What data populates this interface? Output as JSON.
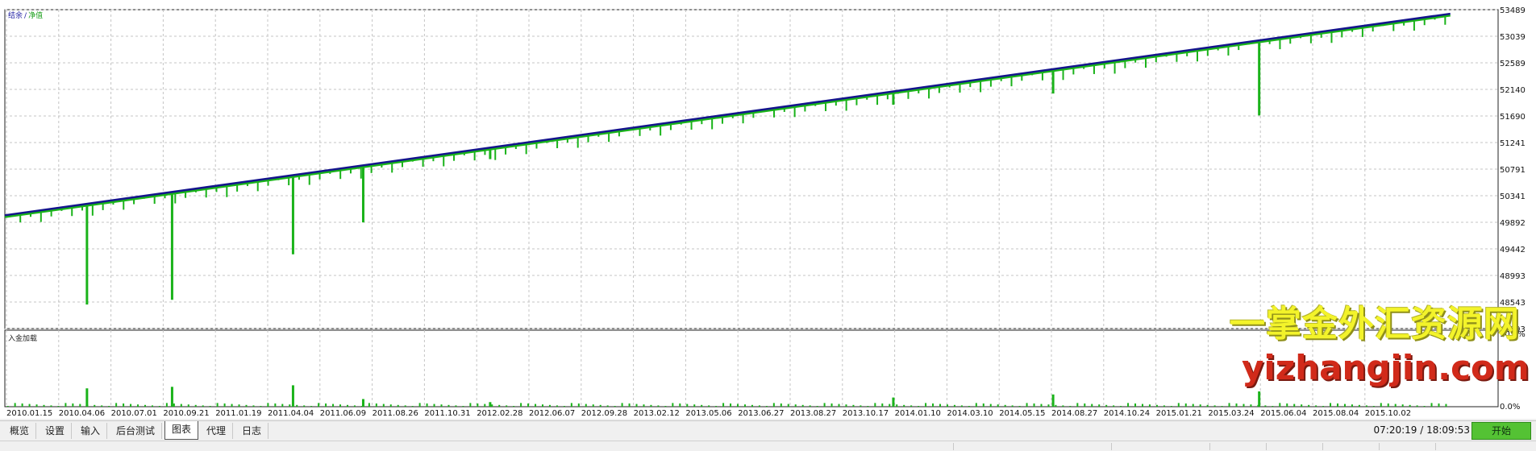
{
  "chart": {
    "legend_balance": "结余",
    "legend_sep": "/",
    "legend_equity": "净值",
    "sub_label": "入金加载",
    "colors": {
      "balance": "#14148c",
      "equity": "#1ab31a",
      "grid": "#c4c4c4",
      "bars": "#1ab31a"
    },
    "y_ticks": [
      "53489",
      "53039",
      "52589",
      "52140",
      "51690",
      "51241",
      "50791",
      "50341",
      "49892",
      "49442",
      "48993",
      "48543",
      "48093"
    ],
    "y_range": [
      48093,
      53489
    ],
    "sub_y_ticks": [
      "10.0%",
      "0.0%"
    ],
    "x_ticks": [
      "2010.01.15",
      "2010.04.06",
      "2010.07.01",
      "2010.09.21",
      "2011.01.19",
      "2011.04.04",
      "2011.06.09",
      "2011.08.26",
      "2011.10.31",
      "2012.02.28",
      "2012.06.07",
      "2012.09.28",
      "2013.02.12",
      "2013.05.06",
      "2013.06.27",
      "2013.08.27",
      "2013.10.17",
      "2014.01.10",
      "2014.03.10",
      "2014.05.15",
      "2014.08.27",
      "2014.10.24",
      "2015.01.21",
      "2015.03.24",
      "2015.06.04",
      "2015.08.04",
      "2015.10.02"
    ],
    "balance_start": 50010,
    "balance_end": 53420,
    "equity_dips": [
      {
        "pos": 0.055,
        "value": 48500,
        "load": 0.24
      },
      {
        "pos": 0.112,
        "value": 48580,
        "load": 0.26
      },
      {
        "pos": 0.193,
        "value": 49350,
        "load": 0.28
      },
      {
        "pos": 0.24,
        "value": 49890,
        "load": 0.1
      },
      {
        "pos": 0.325,
        "value": 50960,
        "load": 0.06
      },
      {
        "pos": 0.595,
        "value": 51880,
        "load": 0.12
      },
      {
        "pos": 0.702,
        "value": 52070,
        "load": 0.16
      },
      {
        "pos": 0.84,
        "value": 51700,
        "load": 0.2
      }
    ]
  },
  "watermark": {
    "line1": "一掌金外汇资源网",
    "line2": "yizhangjin.com"
  },
  "tabs": [
    {
      "label": "概览",
      "active": false
    },
    {
      "label": "设置",
      "active": false
    },
    {
      "label": "输入",
      "active": false
    },
    {
      "label": "后台测试",
      "active": false
    },
    {
      "label": "图表",
      "active": true
    },
    {
      "label": "代理",
      "active": false
    },
    {
      "label": "日志",
      "active": false
    }
  ],
  "status": {
    "time": "07:20:19 / 18:09:53",
    "start_label": "开始"
  }
}
